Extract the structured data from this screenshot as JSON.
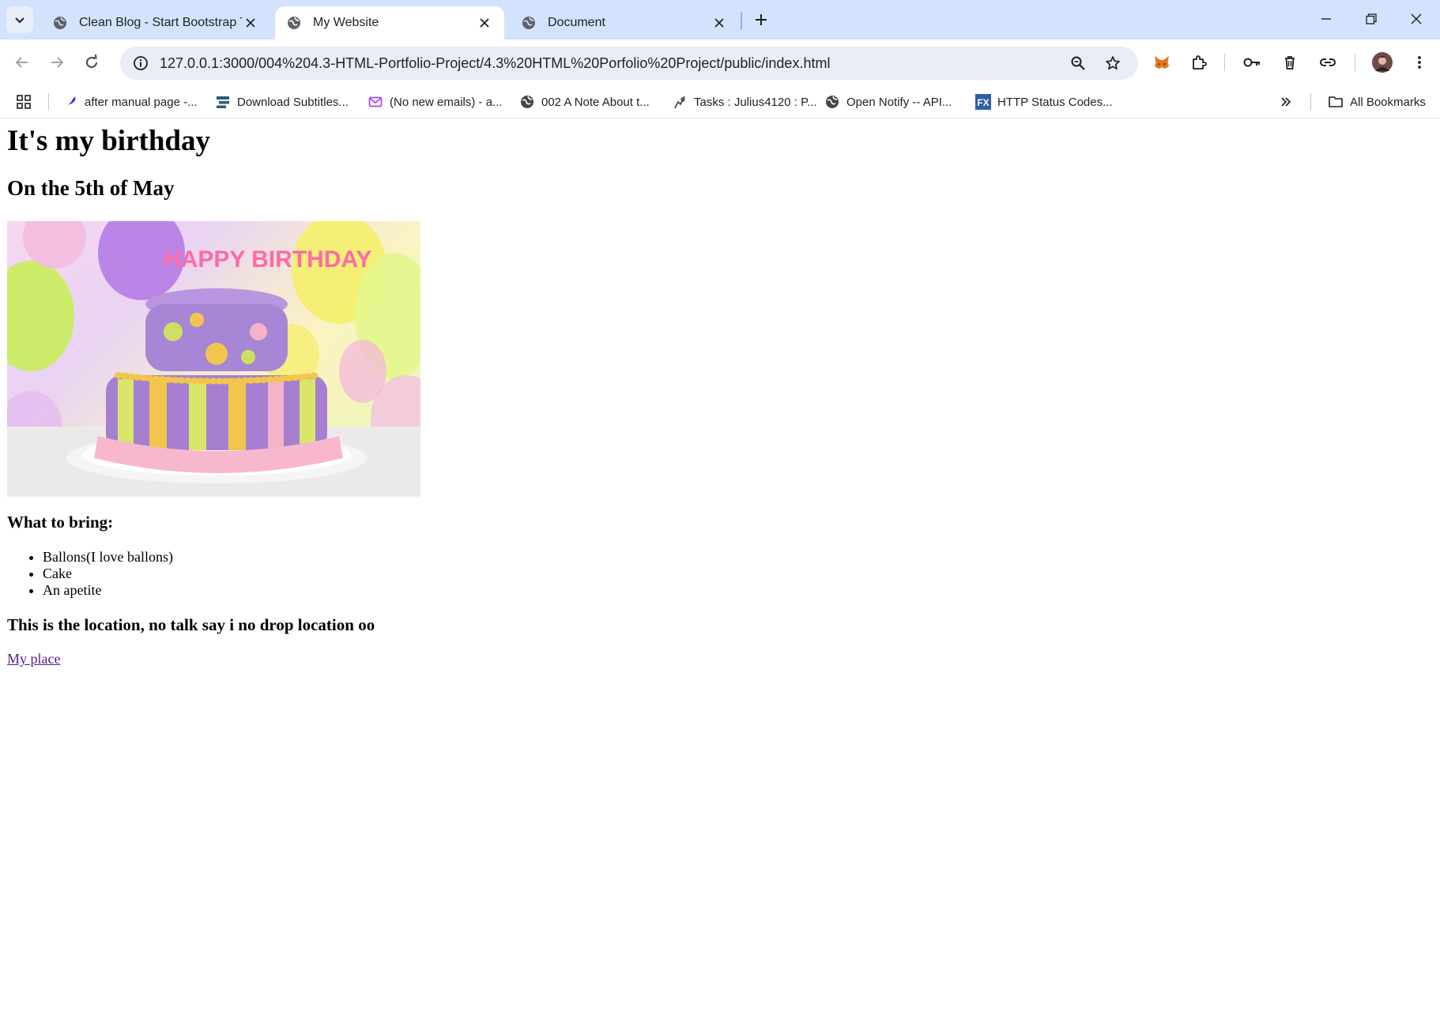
{
  "tabs": [
    {
      "title": "Clean Blog - Start Bootstrap The",
      "active": false
    },
    {
      "title": "My Website",
      "active": true
    },
    {
      "title": "Document",
      "active": false
    }
  ],
  "toolbar": {
    "url": "127.0.0.1:3000/004%204.3-HTML-Portfolio-Project/4.3%20HTML%20Porfolio%20Project/public/index.html"
  },
  "bookmarks": [
    {
      "label": "after manual page -...",
      "icon": "feather-icon"
    },
    {
      "label": "Download Subtitles...",
      "icon": "subtitles-icon"
    },
    {
      "label": "(No new emails) - a...",
      "icon": "mail-icon"
    },
    {
      "label": "002 A Note About t...",
      "icon": "globe-icon"
    },
    {
      "label": "Tasks : Julius4120 : P...",
      "icon": "tasks-icon"
    },
    {
      "label": "Open Notify -- API...",
      "icon": "globe-icon"
    },
    {
      "label": "HTTP Status Codes...",
      "icon": "fx-icon"
    }
  ],
  "all_bookmarks_label": "All Bookmarks",
  "page": {
    "heading": "It's my birthday",
    "subheading": "On the 5th of May",
    "image_lettering": "HAPPY BIRTHDAY",
    "bring_heading": "What to bring:",
    "bring_items": [
      "Ballons(I love ballons)",
      "Cake",
      "An apetite"
    ],
    "location_heading": "This is the location, no talk say i no drop location oo",
    "link_text": "My place"
  },
  "colors": {
    "tabstrip": "#d3e3fd",
    "omnibox": "#e9eef6",
    "visited_link": "#551a8b"
  }
}
